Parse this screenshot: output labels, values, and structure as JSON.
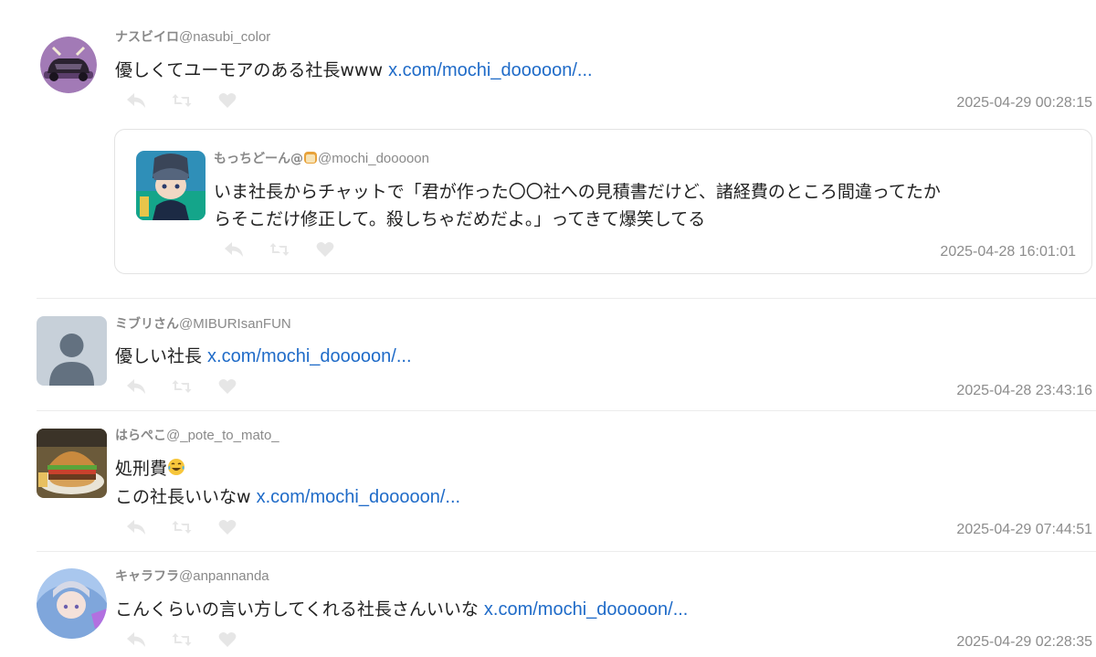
{
  "posts": [
    {
      "display_name": "ナスビイロ",
      "handle": "@nasubi_color",
      "text": "優しくてユーモアのある社長www ",
      "link": "x.com/mochi_dooooon/...",
      "timestamp": "2025-04-29 00:28:15",
      "avatar_icon": "purple-car-avatar",
      "quote": {
        "display_name": "もっちどーん@",
        "handle": "@mochi_dooooon",
        "name_emoji": "bread-icon",
        "text_line1": "いま社長からチャットで「君が作った〇〇社への見積書だけど、諸経費のところ間違ってたか",
        "text_line2": "らそこだけ修正して。殺しちゃだめだよ。」ってきて爆笑してる",
        "timestamp": "2025-04-28 16:01:01",
        "avatar_icon": "anime-character-avatar"
      }
    },
    {
      "display_name": "ミブリさん",
      "handle": "@MIBURIsanFUN",
      "text": "優しい社長 ",
      "link": "x.com/mochi_dooooon/...",
      "timestamp": "2025-04-28 23:43:16",
      "avatar_icon": "default-person-avatar"
    },
    {
      "display_name": "はらぺこ",
      "handle": "@_pote_to_mato_",
      "text_line1": "処刑費",
      "text_line1_emoji": "tears-of-joy-emoji",
      "text_line2": "この社長いいなw ",
      "link": "x.com/mochi_dooooon/...",
      "timestamp": "2025-04-29 07:44:51",
      "avatar_icon": "burger-avatar"
    },
    {
      "display_name": "キャラフラ",
      "handle": "@anpannanda",
      "text": "こんくらいの言い方してくれる社長さんいいな ",
      "link": "x.com/mochi_dooooon/...",
      "timestamp": "2025-04-29 02:28:35",
      "avatar_icon": "anime-girl-avatar"
    }
  ],
  "action_icons": [
    "reply-icon",
    "retweet-icon",
    "like-icon"
  ],
  "colors": {
    "link": "#1f6bc8",
    "muted": "#888888",
    "action_icon": "#e6e6e6",
    "divider": "#ececec"
  }
}
